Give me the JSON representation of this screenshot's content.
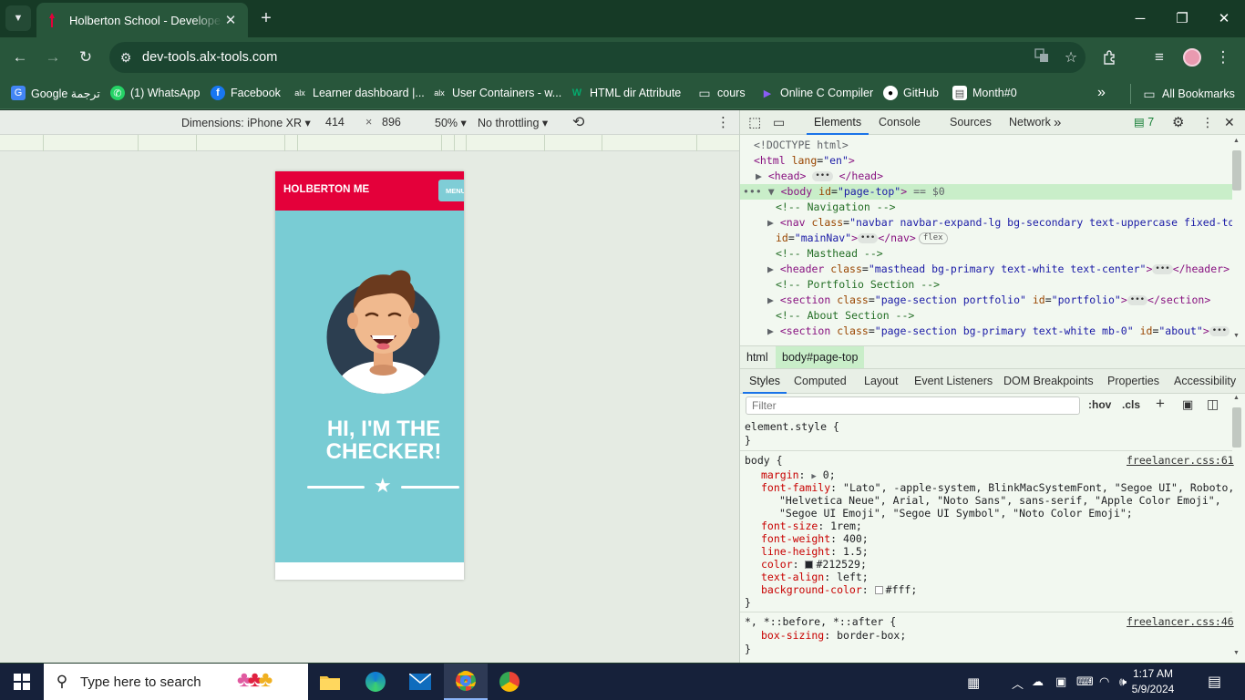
{
  "browser": {
    "tab_title": "Holberton School - Developer t",
    "url": "dev-tools.alx-tools.com",
    "bookmarks": [
      {
        "label": "Google ترجمة"
      },
      {
        "label": "(1) WhatsApp"
      },
      {
        "label": "Facebook"
      },
      {
        "label": "Learner dashboard |..."
      },
      {
        "label": "User Containers - w..."
      },
      {
        "label": "HTML dir Attribute"
      },
      {
        "label": "cours"
      },
      {
        "label": "Online C Compiler"
      },
      {
        "label": "GitHub"
      },
      {
        "label": "Month#0"
      }
    ],
    "all_bookmarks": "All Bookmarks",
    "overflow": "»"
  },
  "device_toolbar": {
    "dimensions": "Dimensions: iPhone XR",
    "width": "414",
    "times": "×",
    "height": "896",
    "zoom": "50%",
    "throttling": "No throttling"
  },
  "page": {
    "brand": "HOLBERTON ME",
    "menu": "MENU",
    "headline_1": "HI, I'M THE",
    "headline_2": "CHECKER!"
  },
  "devtools": {
    "tabs": [
      "Elements",
      "Console",
      "Sources",
      "Network"
    ],
    "issues_count": "7",
    "dom": {
      "doctype": "<!DOCTYPE html>",
      "html_open": "<html",
      "html_lang_attr": "lang",
      "html_lang_val": "\"en\"",
      "html_close": ">",
      "head": "<head>",
      "head_close": "</head>",
      "body_open": "<body",
      "body_id_attr": "id",
      "body_id_val": "\"page-top\"",
      "body_close": ">",
      "body_dollar": "== $0",
      "comment_nav": "<!-- Navigation -->",
      "nav_open": "<nav",
      "nav_class_attr": "class",
      "nav_class_val": "\"navbar navbar-expand-lg bg-secondary text-uppercase fixed-top\"",
      "nav_id_attr": "id",
      "nav_id_val": "\"mainNav\"",
      "nav_close": "</nav>",
      "flex_badge": "flex",
      "comment_masthead": "<!-- Masthead -->",
      "header_open": "<header",
      "header_class_attr": "class",
      "header_class_val": "\"masthead bg-primary text-white text-center\"",
      "header_close": "</header>",
      "comment_portfolio": "<!-- Portfolio Section -->",
      "section1_open": "<section",
      "section1_class_attr": "class",
      "section1_class_val": "\"page-section portfolio\"",
      "section1_id_attr": "id",
      "section1_id_val": "\"portfolio\"",
      "section_close": "</section>",
      "comment_about": "<!-- About Section -->",
      "section2_open": "<section",
      "section2_class_attr": "class",
      "section2_class_val": "\"page-section bg-primary text-white mb-0\"",
      "section2_id_attr": "id",
      "section2_id_val": "\"about\""
    },
    "breadcrumbs": [
      "html",
      "body#page-top"
    ],
    "styles_tabs": [
      "Styles",
      "Computed",
      "Layout",
      "Event Listeners",
      "DOM Breakpoints",
      "Properties",
      "Accessibility"
    ],
    "filter_placeholder": "Filter",
    "hov": ":hov",
    "cls": ".cls",
    "styles": {
      "element_style": "element.style {",
      "brace_close": "}",
      "body_selector": "body {",
      "body_source": "freelancer.css:61",
      "rules": [
        {
          "prop": "margin",
          "value": "0;"
        },
        {
          "prop": "font-family",
          "value": "\"Lato\", -apple-system, BlinkMacSystemFont, \"Segoe UI\", Roboto,"
        },
        {
          "prop": "",
          "value": "\"Helvetica Neue\", Arial, \"Noto Sans\", sans-serif, \"Apple Color Emoji\","
        },
        {
          "prop": "",
          "value": "\"Segoe UI Emoji\", \"Segoe UI Symbol\", \"Noto Color Emoji\";"
        },
        {
          "prop": "font-size",
          "value": "1rem;"
        },
        {
          "prop": "font-weight",
          "value": "400;"
        },
        {
          "prop": "line-height",
          "value": "1.5;"
        },
        {
          "prop": "color",
          "value": "#212529;"
        },
        {
          "prop": "text-align",
          "value": "left;"
        },
        {
          "prop": "background-color",
          "value": "#fff;"
        }
      ],
      "universal_selector": "*, *::before, *::after {",
      "universal_source": "freelancer.css:46",
      "box_sizing_prop": "box-sizing",
      "box_sizing_val": "border-box;"
    }
  },
  "taskbar": {
    "search_placeholder": "Type here to search",
    "time": "1:17 AM",
    "date": "5/9/2024"
  },
  "colors": {
    "brand_red": "#e4003a",
    "masthead_teal": "#79ccd4",
    "chrome_green": "#28563b",
    "titlebar_green": "#163a26"
  }
}
